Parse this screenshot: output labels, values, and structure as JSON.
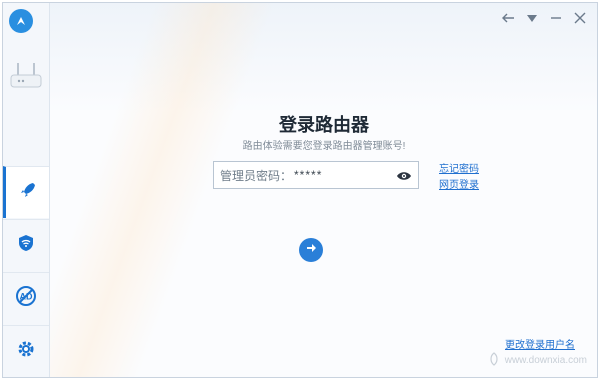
{
  "title": "登录路由器",
  "subtitle": "路由体验需要您登录路由器管理账号!",
  "password": {
    "label": "管理员密码：",
    "value": "*****"
  },
  "links": {
    "forgot": "忘记密码",
    "web_login": "网页登录",
    "change_username": "更改登录用户名"
  },
  "nav": [
    {
      "name": "speedup",
      "icon": "rocket-icon",
      "active": true
    },
    {
      "name": "wifi",
      "icon": "wifi-shield-icon",
      "active": false
    },
    {
      "name": "adblock",
      "icon": "ad-block-icon",
      "active": false
    },
    {
      "name": "settings",
      "icon": "gear-icon",
      "active": false
    }
  ],
  "watermark": "www.downxia.com",
  "colors": {
    "accent": "#1a73d1",
    "link": "#1f6fcf",
    "border": "#b9c5d2"
  }
}
